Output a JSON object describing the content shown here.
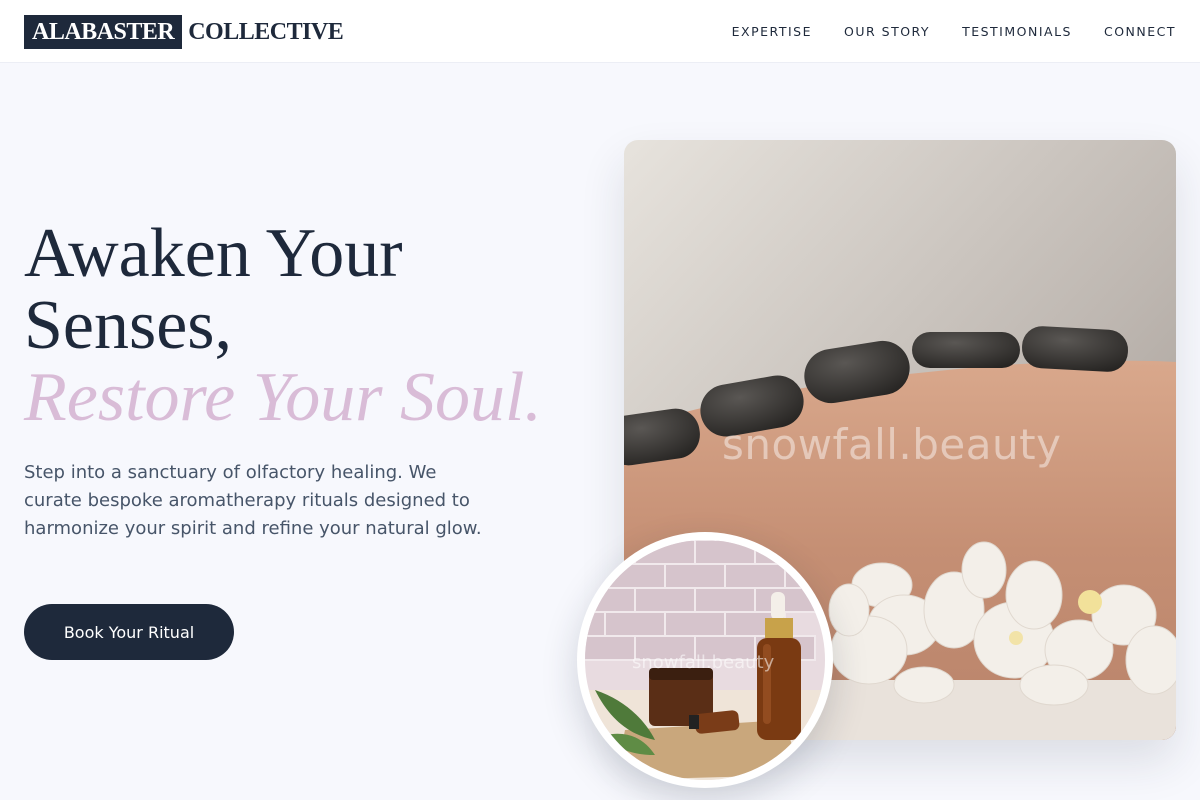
{
  "brand": {
    "boxed": "ALABASTER",
    "rest": "COLLECTIVE"
  },
  "nav": {
    "items": [
      "EXPERTISE",
      "OUR STORY",
      "TESTIMONIALS",
      "CONNECT"
    ]
  },
  "hero": {
    "line1": "Awaken Your",
    "line2": "Senses,",
    "line3_accent": "Restore Your Soul.",
    "description": "Step into a sanctuary of olfactory healing. We curate bespoke aromatherapy rituals designed to harmonize your spirit and refine your natural glow.",
    "cta_label": "Book Your Ritual"
  },
  "images": {
    "main_watermark": "snowfall.beauty",
    "circle_watermark": "snowfall.beauty"
  },
  "colors": {
    "primary": "#1e293b",
    "accent": "#d9bcd7",
    "background": "#f7f8fd"
  }
}
